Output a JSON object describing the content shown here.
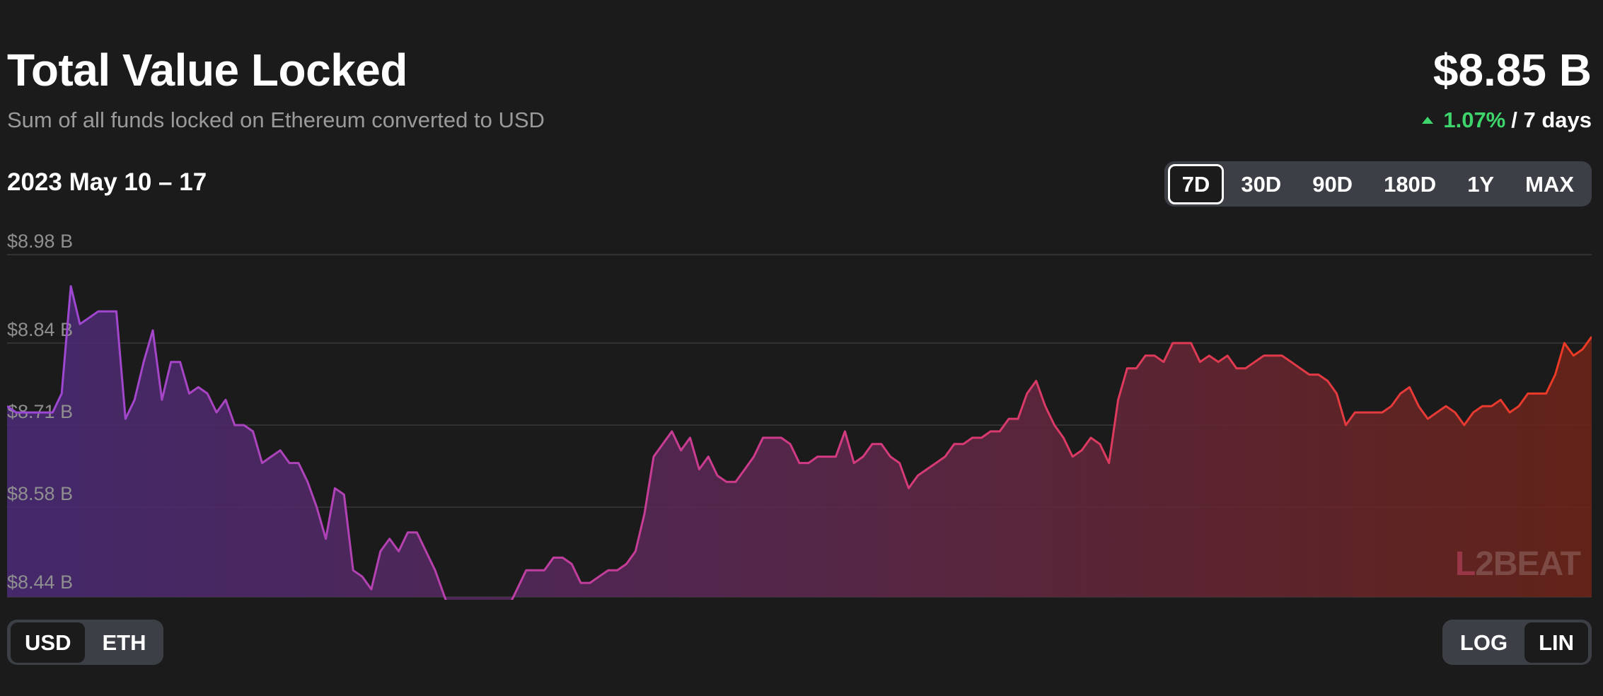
{
  "header": {
    "title": "Total Value Locked",
    "subtitle": "Sum of all funds locked on Ethereum converted to USD",
    "tvl_value": "$8.85 B",
    "change_percent": "1.07%",
    "change_period": "/ 7 days",
    "date_range": "2023 May 10 – 17"
  },
  "time_ranges": {
    "options": [
      "7D",
      "30D",
      "90D",
      "180D",
      "1Y",
      "MAX"
    ],
    "selected": "7D"
  },
  "currency": {
    "options": [
      "USD",
      "ETH"
    ],
    "selected": "USD"
  },
  "scale": {
    "options": [
      "LOG",
      "LIN"
    ],
    "selected": "LIN"
  },
  "watermark": {
    "left": "L",
    "two": "2",
    "right": "BEAT"
  },
  "colors": {
    "gradient_start": "#9a48d8",
    "gradient_mid": "#d23a86",
    "gradient_end": "#ed3a22",
    "positive": "#3ed66c",
    "background": "#1b1b1b"
  },
  "chart_data": {
    "type": "area",
    "title": "",
    "xlabel": "",
    "ylabel": "",
    "grid": true,
    "ylim": [
      8.44,
      8.98
    ],
    "y_ticks": [
      8.98,
      8.84,
      8.71,
      8.58,
      8.44
    ],
    "y_tick_labels": [
      "$8.98 B",
      "$8.84 B",
      "$8.71 B",
      "$8.58 B",
      "$8.44 B"
    ],
    "x_range": [
      "2023-05-10",
      "2023-05-17"
    ],
    "values": [
      8.74,
      8.73,
      8.73,
      8.73,
      8.73,
      8.73,
      8.76,
      8.93,
      8.87,
      8.88,
      8.89,
      8.89,
      8.89,
      8.72,
      8.75,
      8.81,
      8.86,
      8.75,
      8.81,
      8.81,
      8.76,
      8.77,
      8.76,
      8.73,
      8.75,
      8.71,
      8.71,
      8.7,
      8.65,
      8.66,
      8.67,
      8.65,
      8.65,
      8.62,
      8.58,
      8.53,
      8.61,
      8.6,
      8.48,
      8.47,
      8.45,
      8.51,
      8.53,
      8.51,
      8.54,
      8.54,
      8.51,
      8.48,
      8.44,
      8.4,
      8.42,
      8.42,
      8.39,
      8.4,
      8.43,
      8.42,
      8.45,
      8.48,
      8.48,
      8.48,
      8.5,
      8.5,
      8.49,
      8.46,
      8.46,
      8.47,
      8.48,
      8.48,
      8.49,
      8.51,
      8.57,
      8.66,
      8.68,
      8.7,
      8.67,
      8.69,
      8.64,
      8.66,
      8.63,
      8.62,
      8.62,
      8.64,
      8.66,
      8.69,
      8.69,
      8.69,
      8.68,
      8.65,
      8.65,
      8.66,
      8.66,
      8.66,
      8.7,
      8.65,
      8.66,
      8.68,
      8.68,
      8.66,
      8.65,
      8.61,
      8.63,
      8.64,
      8.65,
      8.66,
      8.68,
      8.68,
      8.69,
      8.69,
      8.7,
      8.7,
      8.72,
      8.72,
      8.76,
      8.78,
      8.74,
      8.71,
      8.69,
      8.66,
      8.67,
      8.69,
      8.68,
      8.65,
      8.75,
      8.8,
      8.8,
      8.82,
      8.82,
      8.81,
      8.84,
      8.84,
      8.84,
      8.81,
      8.82,
      8.81,
      8.82,
      8.8,
      8.8,
      8.81,
      8.82,
      8.82,
      8.82,
      8.81,
      8.8,
      8.79,
      8.79,
      8.78,
      8.76,
      8.71,
      8.73,
      8.73,
      8.73,
      8.73,
      8.74,
      8.76,
      8.77,
      8.74,
      8.72,
      8.73,
      8.74,
      8.73,
      8.71,
      8.73,
      8.74,
      8.74,
      8.75,
      8.73,
      8.74,
      8.76,
      8.76,
      8.76,
      8.79,
      8.84,
      8.82,
      8.83,
      8.85
    ]
  }
}
